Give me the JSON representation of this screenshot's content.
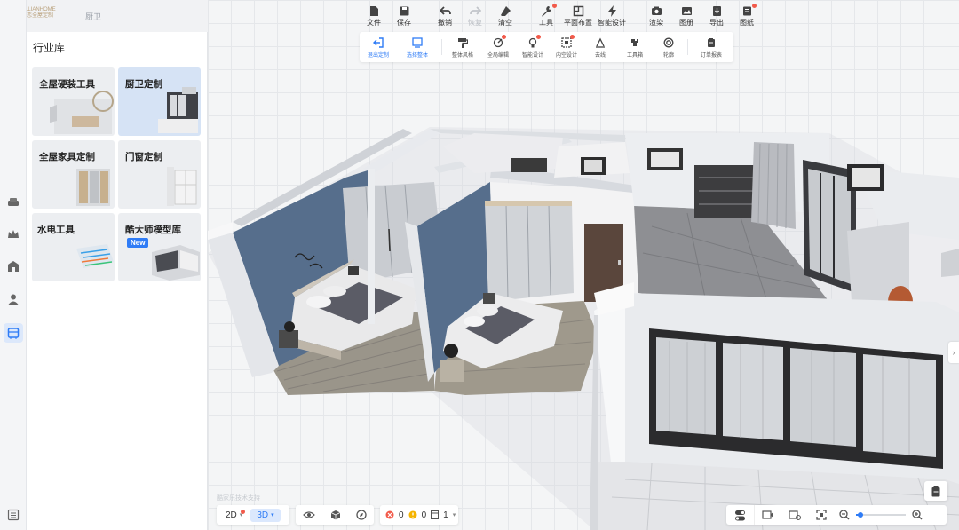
{
  "brand": {
    "line1": "ELLIANHOME",
    "line2": "伊恋全屋定制"
  },
  "breadcrumb": "厨卫",
  "toolbar": [
    {
      "label": "文件",
      "icon": "file-icon",
      "dot": false,
      "dim": false
    },
    {
      "label": "保存",
      "icon": "save-icon",
      "dot": false,
      "dim": false
    },
    {
      "label": "撤销",
      "icon": "undo-icon",
      "dot": false,
      "dim": false
    },
    {
      "label": "恢复",
      "icon": "redo-icon",
      "dot": false,
      "dim": true
    },
    {
      "label": "清空",
      "icon": "eraser-icon",
      "dot": false,
      "dim": false
    },
    {
      "label": "工具",
      "icon": "wrench-icon",
      "dot": true,
      "dim": false
    },
    {
      "label": "平面布置",
      "icon": "floorplan-icon",
      "dot": false,
      "dim": false
    },
    {
      "label": "智能设计",
      "icon": "lightning-icon",
      "dot": false,
      "dim": false
    },
    {
      "label": "渲染",
      "icon": "camera-icon",
      "dot": false,
      "dim": false
    },
    {
      "label": "图册",
      "icon": "album-icon",
      "dot": false,
      "dim": false
    },
    {
      "label": "导出",
      "icon": "export-icon",
      "dot": false,
      "dim": false
    },
    {
      "label": "图纸",
      "icon": "drawing-icon",
      "dot": true,
      "dim": false
    }
  ],
  "sub_toolbar": [
    {
      "label": "退出定制",
      "icon": "exit-icon",
      "blue": true,
      "dot": false
    },
    {
      "label": "选择整体",
      "icon": "select-all-icon",
      "blue": true,
      "dot": false
    },
    {
      "label": "整体风格",
      "icon": "paint-roller-icon",
      "blue": false,
      "dot": false
    },
    {
      "label": "全局编辑",
      "icon": "global-edit-icon",
      "blue": false,
      "dot": true
    },
    {
      "label": "智能设计",
      "icon": "smart-design-icon",
      "blue": false,
      "dot": true
    },
    {
      "label": "内空设计",
      "icon": "inner-space-icon",
      "blue": false,
      "dot": true
    },
    {
      "label": "去线",
      "icon": "line-remove-icon",
      "blue": false,
      "dot": false
    },
    {
      "label": "工具箱",
      "icon": "toolbox-icon",
      "blue": false,
      "dot": false
    },
    {
      "label": "轮廓",
      "icon": "outline-icon",
      "blue": false,
      "dot": false
    },
    {
      "label": "订单报表",
      "icon": "report-icon",
      "blue": false,
      "dot": false
    }
  ],
  "panel": {
    "title": "行业库",
    "cards": [
      {
        "label": "全屋硬装工具",
        "selected": false,
        "isNew": false
      },
      {
        "label": "厨卫定制",
        "selected": true,
        "isNew": false
      },
      {
        "label": "全屋家具定制",
        "selected": false,
        "isNew": false
      },
      {
        "label": "门窗定制",
        "selected": false,
        "isNew": false
      },
      {
        "label": "水电工具",
        "selected": false,
        "isNew": false
      },
      {
        "label": "酷大师模型库",
        "selected": false,
        "isNew": true
      }
    ],
    "new_badge": "New"
  },
  "rail": [
    "sofa-icon",
    "crown-icon",
    "building-icon",
    "user-icon",
    "library-icon"
  ],
  "bottom": {
    "view_2d": "2D",
    "view_3d": "3D",
    "error_count": "0",
    "warning_count": "0",
    "page_count": "1"
  },
  "watermark": "酷家乐技术支持",
  "colors": {
    "accent": "#2f7cf6",
    "alert": "#f25a4a",
    "warning": "#f5b400"
  }
}
